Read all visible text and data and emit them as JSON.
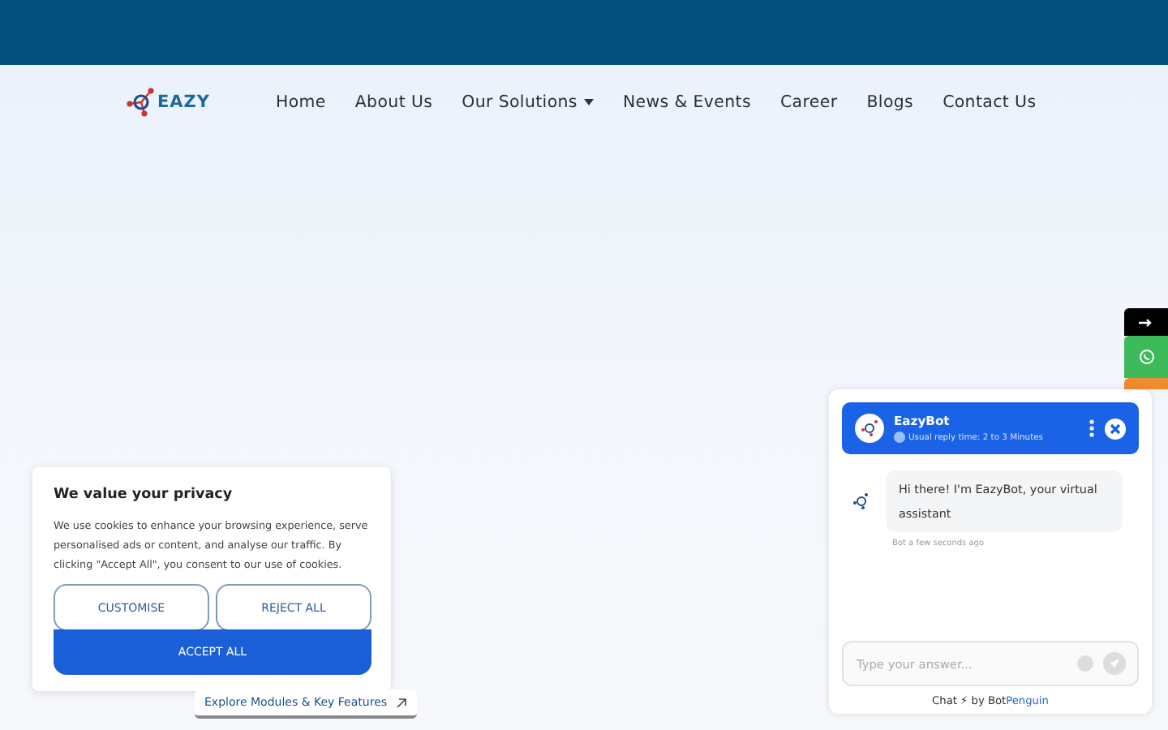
{
  "logo": {
    "text": "EAZY"
  },
  "nav": [
    {
      "label": "Home",
      "dropdown": false
    },
    {
      "label": "About Us",
      "dropdown": false
    },
    {
      "label": "Our Solutions",
      "dropdown": true
    },
    {
      "label": "News & Events",
      "dropdown": false
    },
    {
      "label": "Career",
      "dropdown": false
    },
    {
      "label": "Blogs",
      "dropdown": false
    },
    {
      "label": "Contact Us",
      "dropdown": false
    }
  ],
  "side_tabs": [
    {
      "kind": "arrow",
      "color": "#000000"
    },
    {
      "kind": "whatsapp",
      "color": "#3dbb5a"
    },
    {
      "kind": "plain",
      "color": "#f28b30"
    }
  ],
  "cookie": {
    "title": "We value your privacy",
    "text": "We use cookies to enhance your browsing experience, serve personalised ads or content, and analyse our traffic. By clicking \"Accept All\", you consent to our use of cookies.",
    "buttons": [
      "CUSTOMISE",
      "REJECT ALL"
    ],
    "primary": "ACCEPT ALL"
  },
  "explore_link": {
    "label": "Explore Modules & Key Features"
  },
  "chat": {
    "name": "EazyBot",
    "status": "Usual reply time: 2 to 3 Minutes",
    "message": "Hi there! I'm EazyBot, your virtual assistant",
    "meta": "Bot a few seconds ago",
    "placeholder": "Type your answer...",
    "footer": "Chat ⚡ by Bot",
    "footer_link": "Penguin"
  }
}
